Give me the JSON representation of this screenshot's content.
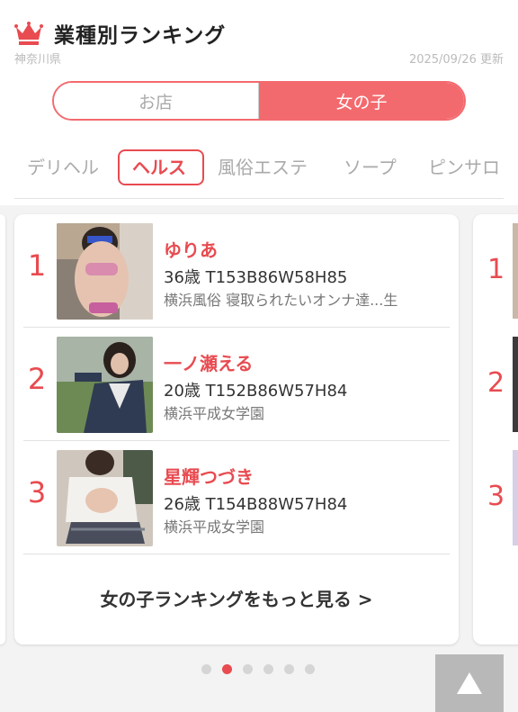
{
  "header": {
    "title": "業種別ランキング",
    "region": "神奈川県",
    "updated": "2025/09/26 更新"
  },
  "segment": {
    "shop_label": "お店",
    "girl_label": "女の子",
    "selected": "女の子"
  },
  "categories": [
    "デリヘル",
    "ヘルス",
    "風俗エステ",
    "ソープ",
    "ピンサロ"
  ],
  "active_category": "ヘルス",
  "ranking": [
    {
      "rank": "1",
      "name": "ゆりあ",
      "stats": "36歳 T153B86W58H85",
      "shop": "横浜風俗 寝取られたいオンナ達...生"
    },
    {
      "rank": "2",
      "name": "一ノ瀬える",
      "stats": "20歳 T152B86W57H84",
      "shop": "横浜平成女学園"
    },
    {
      "rank": "3",
      "name": "星輝つづき",
      "stats": "26歳 T154B88W57H84",
      "shop": "横浜平成女学園"
    }
  ],
  "next_card_ranks": [
    "1",
    "2",
    "3"
  ],
  "more_link": "女の子ランキングをもっと見る >",
  "pager": {
    "count": 6,
    "active": 2
  },
  "colors": {
    "accent": "#e84b50",
    "segment_fill": "#f36a6e"
  },
  "icons": {
    "title": "crown-icon",
    "to_top": "triangle-up-icon"
  }
}
